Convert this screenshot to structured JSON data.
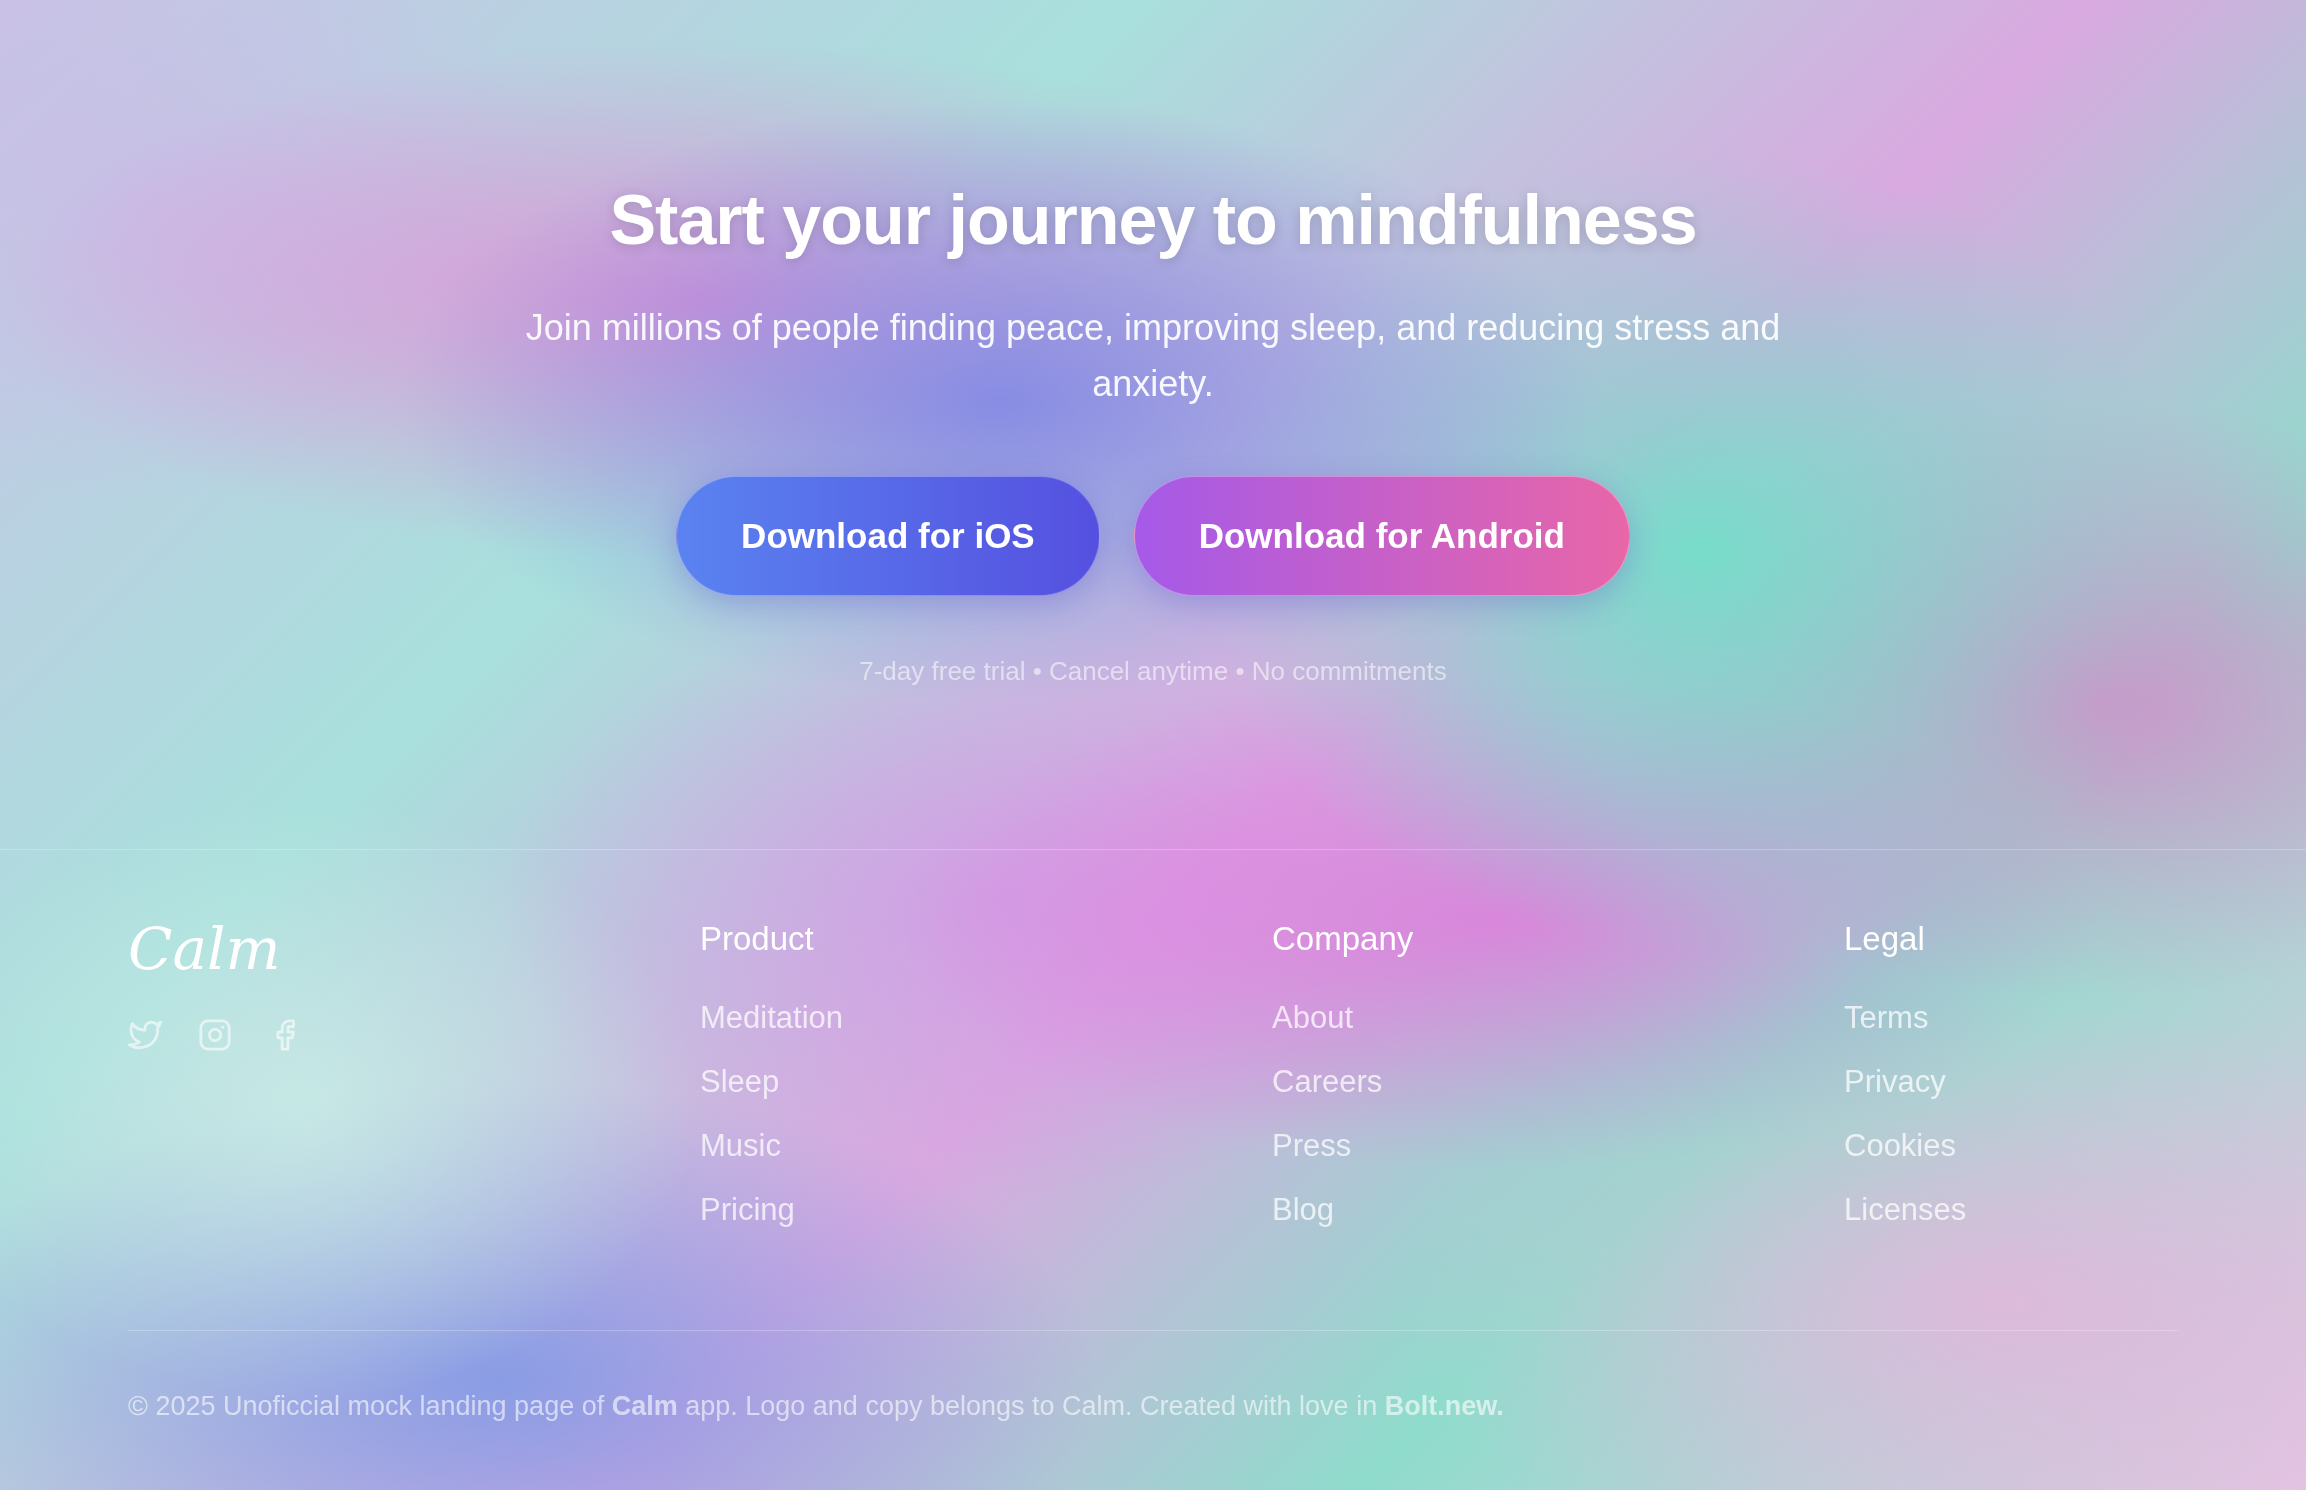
{
  "hero": {
    "title": "Start your journey to mindfulness",
    "subtitle": "Join millions of people finding peace, improving sleep, and reducing stress and anxiety.",
    "buttons": [
      {
        "label": "Download for iOS",
        "kind": "ios"
      },
      {
        "label": "Download for Android",
        "kind": "android"
      }
    ],
    "note": "7-day free trial • Cancel anytime • No commitments"
  },
  "footer": {
    "logo": "Calm",
    "social": [
      {
        "kind": "twitter"
      },
      {
        "kind": "instagram"
      },
      {
        "kind": "facebook"
      }
    ],
    "columns": [
      {
        "heading": "Product",
        "links": [
          "Meditation",
          "Sleep",
          "Music",
          "Pricing"
        ]
      },
      {
        "heading": "Company",
        "links": [
          "About",
          "Careers",
          "Press",
          "Blog"
        ]
      },
      {
        "heading": "Legal",
        "links": [
          "Terms",
          "Privacy",
          "Cookies",
          "Licenses"
        ]
      }
    ],
    "copyright": "© 2025 Unoficcial mock landing page of **Calm** app. Logo and copy belongs to Calm. Created with love in **Bolt.new.**"
  }
}
